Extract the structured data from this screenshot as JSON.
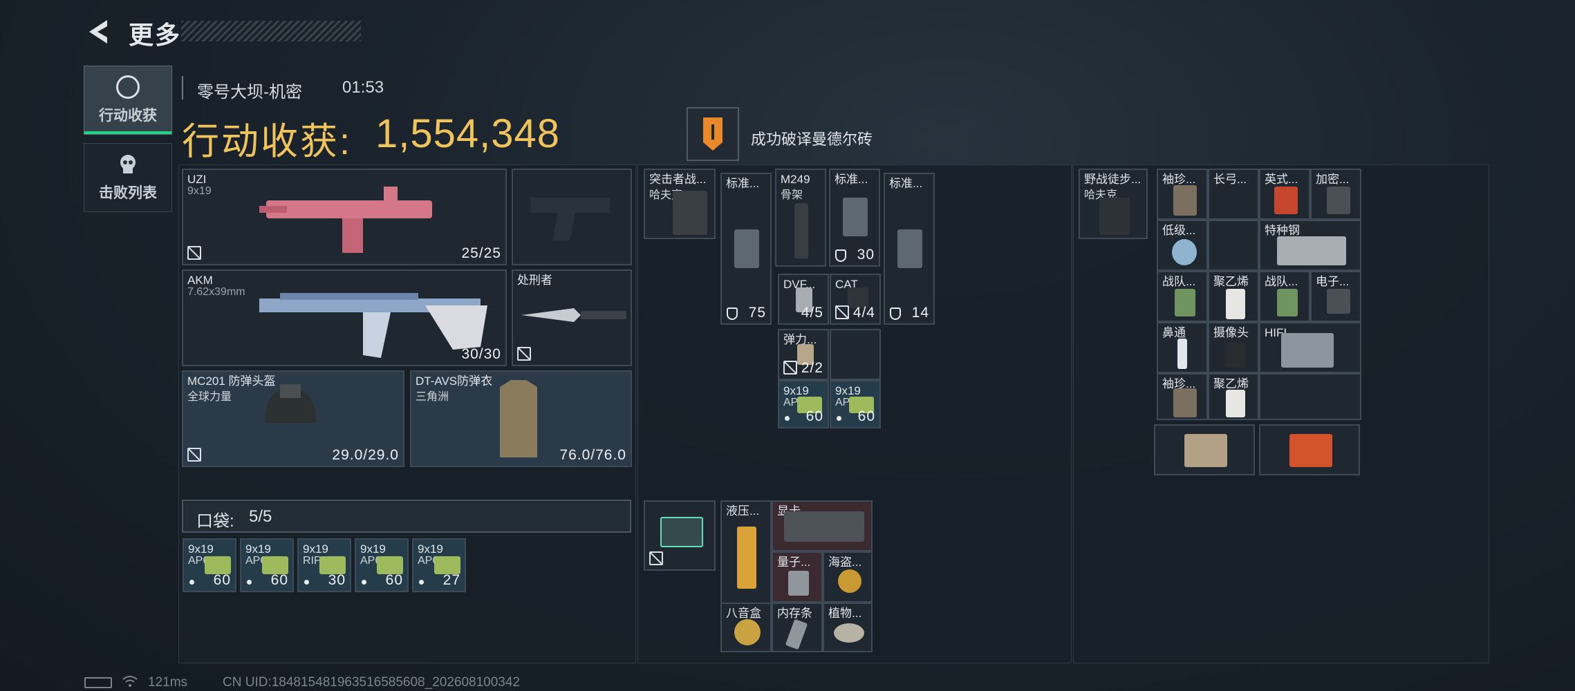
{
  "header": {
    "title": "更多"
  },
  "tabs": [
    {
      "label": "行动收获",
      "active": true
    },
    {
      "label": "击败列表",
      "active": false
    }
  ],
  "match": {
    "map": "零号大坝-机密",
    "time": "01:53"
  },
  "haul": {
    "label": "行动收获:",
    "value": "1,554,348"
  },
  "achievement": {
    "text": "成功破译曼德尔砖"
  },
  "weapons": [
    {
      "name": "UZI",
      "sub": "9x19",
      "ammo": "25/25"
    },
    {
      "name": "AKM",
      "sub": "7.62x39mm",
      "ammo": "30/30"
    },
    {
      "name": "处刑者"
    }
  ],
  "armor": [
    {
      "name": "MC201 防弹头盔",
      "sub": "全球力量",
      "durability": "29.0/29.0"
    },
    {
      "name": "DT-AVS防弹衣",
      "sub": "三角洲",
      "durability": "76.0/76.0"
    }
  ],
  "pocket": {
    "label": "口袋:",
    "value": "5/5",
    "items": [
      {
        "caliber": "9x19",
        "type": "AP6.3",
        "count": "60"
      },
      {
        "caliber": "9x19",
        "type": "AP6.3",
        "count": "60"
      },
      {
        "caliber": "9x19",
        "type": "RIP",
        "count": "30"
      },
      {
        "caliber": "9x19",
        "type": "AP6.3",
        "count": "60"
      },
      {
        "caliber": "9x19",
        "type": "AP6.3",
        "count": "27"
      }
    ]
  },
  "chest_rig": {
    "name": "突击者战...",
    "sub": "哈夫克",
    "items": [
      {
        "name": "标准...",
        "count": "75"
      },
      {
        "name": "M249",
        "sub": "骨架"
      },
      {
        "name": "标准...",
        "count": "30"
      },
      {
        "name": "标准...",
        "count": "14"
      },
      {
        "name": "DVF...",
        "count": "4/5"
      },
      {
        "name": "CAT",
        "count": "4/4"
      },
      {
        "name": "弹力...",
        "count": "2/2"
      },
      {
        "caliber": "9x19",
        "type": "AP6.3",
        "count": "60"
      },
      {
        "caliber": "9x19",
        "type": "AP6.3",
        "count": "60"
      }
    ]
  },
  "safe_box": {
    "items": [
      {
        "name": "液压..."
      },
      {
        "name": "显卡"
      },
      {
        "name": "量子..."
      },
      {
        "name": "海盗..."
      },
      {
        "name": "八音盒"
      },
      {
        "name": "内存条"
      },
      {
        "name": "植物..."
      }
    ]
  },
  "backpack": {
    "name": "野战徒步...",
    "sub": "哈夫克",
    "items": [
      {
        "name": "袖珍..."
      },
      {
        "name": "长弓..."
      },
      {
        "name": "英式..."
      },
      {
        "name": "加密..."
      },
      {
        "name": "低级..."
      },
      {
        "name": "特种钢"
      },
      {
        "name": "战队..."
      },
      {
        "name": "聚乙烯"
      },
      {
        "name": "战队..."
      },
      {
        "name": "电子..."
      },
      {
        "name": "鼻通"
      },
      {
        "name": "摄像头"
      },
      {
        "name": "HIFI..."
      },
      {
        "name": "袖珍..."
      },
      {
        "name": "聚乙烯"
      }
    ]
  },
  "footer": {
    "ping": "121ms",
    "uid": "CN UID:18481548196351658560​8_202608100342"
  },
  "colors": {
    "accent": "#f1c45a",
    "active_tab": "#1fd289"
  }
}
